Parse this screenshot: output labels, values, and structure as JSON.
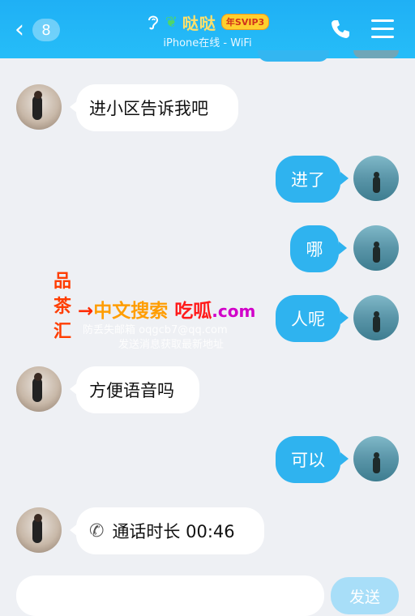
{
  "header": {
    "back_count": "8",
    "contact_name": "哒哒",
    "vip_badge": "年SVIP3",
    "status": "iPhone在线 - WiFi"
  },
  "messages": [
    {
      "side": "left",
      "text": "进小区告诉我吧"
    },
    {
      "side": "right",
      "text": "进了"
    },
    {
      "side": "right",
      "text": "哪"
    },
    {
      "side": "right",
      "text": "人呢"
    },
    {
      "side": "left",
      "text": "方便语音吗"
    },
    {
      "side": "right",
      "text": "可以"
    },
    {
      "side": "left",
      "call_label": "通话时长 00:46"
    }
  ],
  "watermark": {
    "col1": "品",
    "col2": "茶",
    "col3": "汇",
    "arrow": "→",
    "main1": "中文搜索",
    "main2": "吃呱",
    "main3": ".com",
    "line1": "防丢失邮箱 oqgcb7@qq.com",
    "line2": "发送消息获取最新地址"
  },
  "input": {
    "send_label": "发送"
  },
  "colors": {
    "header": "#1fb0f5",
    "outgoing_bubble": "#2fb3ef",
    "incoming_bubble": "#ffffff",
    "background": "#eef0f4"
  },
  "icons": [
    "chevron-left-icon",
    "ear-icon",
    "sprout-icon",
    "phone-icon",
    "menu-icon",
    "call-icon"
  ]
}
